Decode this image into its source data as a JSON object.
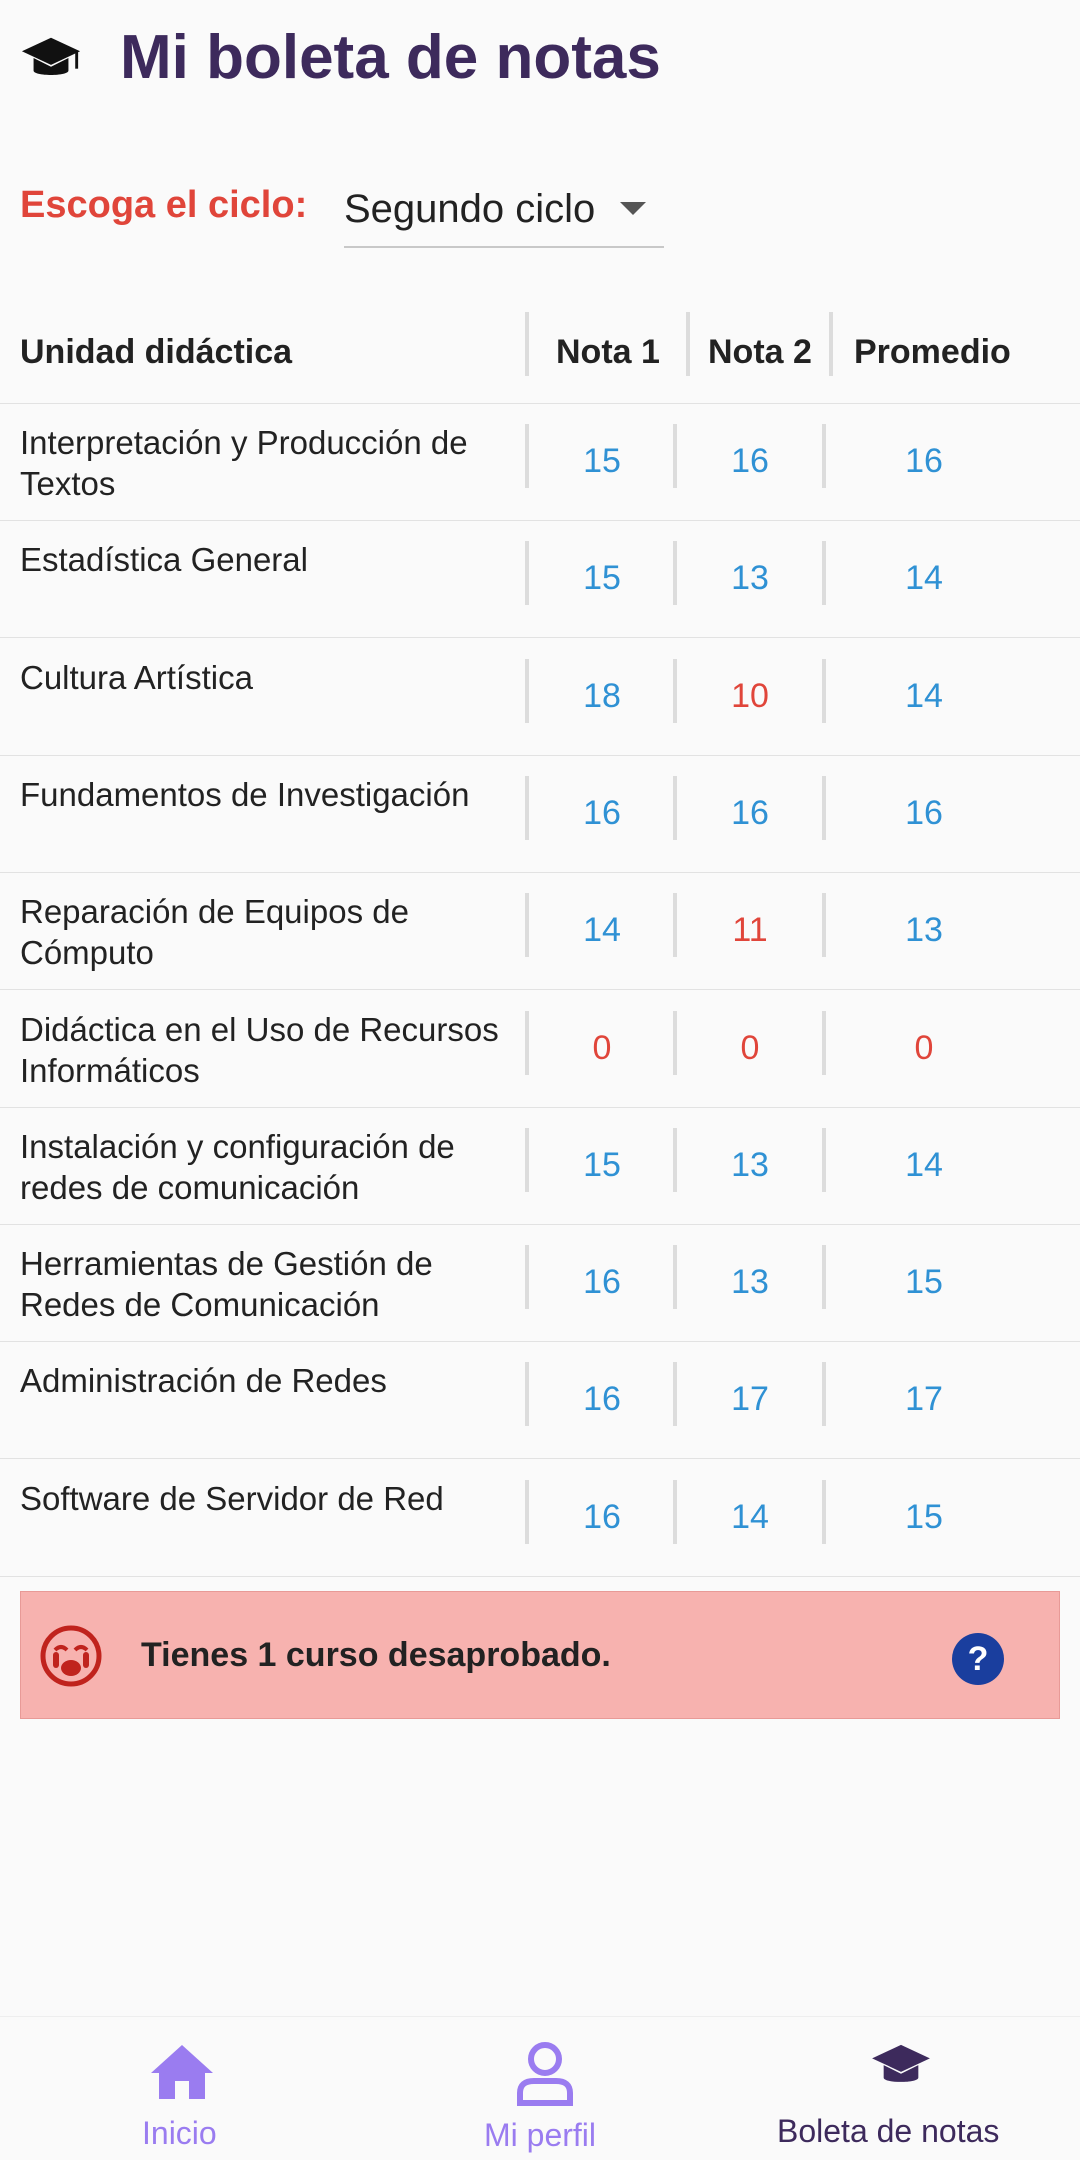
{
  "header": {
    "title": "Mi boleta de notas",
    "icon": "graduation-cap-icon"
  },
  "cycle": {
    "label": "Escoga el ciclo:",
    "selected": "Segundo ciclo"
  },
  "table": {
    "headers": [
      "Unidad didáctica",
      "Nota 1",
      "Nota 2",
      "Promedio"
    ],
    "rows": [
      {
        "unidad": "Interpretación y Producción de Textos",
        "nota1": "15",
        "nota2": "16",
        "promedio": "16"
      },
      {
        "unidad": "Estadística General",
        "nota1": "15",
        "nota2": "13",
        "promedio": "14"
      },
      {
        "unidad": "Cultura Artística",
        "nota1": "18",
        "nota2": "10",
        "promedio": "14"
      },
      {
        "unidad": "Fundamentos de Investigación",
        "nota1": "16",
        "nota2": "16",
        "promedio": "16"
      },
      {
        "unidad": "Reparación de Equipos de Cómputo",
        "nota1": "14",
        "nota2": "11",
        "promedio": "13"
      },
      {
        "unidad": "Didáctica en el Uso de Recursos Informáticos",
        "nota1": "0",
        "nota2": "0",
        "promedio": "0"
      },
      {
        "unidad": "Instalación y configuración de redes de comunicación",
        "nota1": "15",
        "nota2": "13",
        "promedio": "14"
      },
      {
        "unidad": "Herramientas de Gestión de Redes de Comunicación",
        "nota1": "16",
        "nota2": "13",
        "promedio": "15"
      },
      {
        "unidad": "Administración de Redes",
        "nota1": "16",
        "nota2": "17",
        "promedio": "17"
      },
      {
        "unidad": "Software de Servidor de Red",
        "nota1": "16",
        "nota2": "14",
        "promedio": "15"
      }
    ]
  },
  "alert": {
    "message": "Tienes 1 curso desaprobado.",
    "icon": "sad-face-icon",
    "help_icon": "help-icon"
  },
  "bottom_nav": [
    {
      "label": "Inicio",
      "icon": "home-icon",
      "active": false
    },
    {
      "label": "Mi perfil",
      "icon": "person-icon",
      "active": false
    },
    {
      "label": "Boleta de notas",
      "icon": "graduation-cap-icon",
      "active": true
    }
  ],
  "colors": {
    "title": "#3d2a5c",
    "accent_red": "#e0453a",
    "grade_pass": "#2f91d4",
    "grade_fail": "#e0453a",
    "alert_bg": "#f7b2af",
    "nav_inactive": "#9a7cf0",
    "nav_active": "#3d2a5c"
  }
}
